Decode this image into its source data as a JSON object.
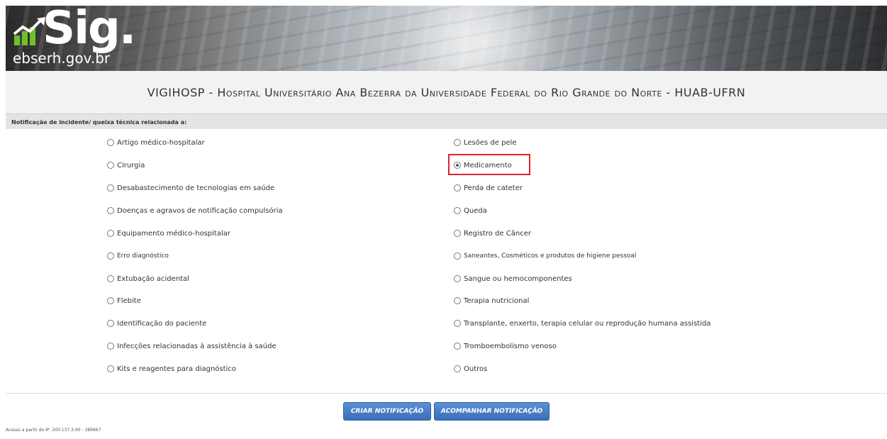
{
  "header": {
    "logo_text": "Sig",
    "logo_dot": ".",
    "logo_domain": "ebserh.gov.br",
    "logo_icon": "chart-growth-icon"
  },
  "title": "VIGIHOSP - Hospital Universitário Ana Bezerra da Universidade Federal do Rio Grande do Norte - HUAB-UFRN",
  "section": {
    "label": "Notificação de incidente/ queixa técnica relacionada a:"
  },
  "options": {
    "left": [
      {
        "label": "Artigo médico-hospitalar",
        "checked": false
      },
      {
        "label": "Cirurgia",
        "checked": false
      },
      {
        "label": "Desabastecimento de tecnologias em saúde",
        "checked": false
      },
      {
        "label": "Doenças e agravos de notificação compulsória",
        "checked": false
      },
      {
        "label": "Equipamento médico-hospitalar",
        "checked": false
      },
      {
        "label": "Erro diagnóstico",
        "checked": false
      },
      {
        "label": "Extubação acidental",
        "checked": false
      },
      {
        "label": "Flebite",
        "checked": false
      },
      {
        "label": "Identificação do paciente",
        "checked": false
      },
      {
        "label": "Infecções relacionadas à assistência à saúde",
        "checked": false
      },
      {
        "label": "Kits e reagentes para diagnóstico",
        "checked": false
      }
    ],
    "right": [
      {
        "label": "Lesões de pele",
        "checked": false
      },
      {
        "label": "Medicamento",
        "checked": true
      },
      {
        "label": "Perda de cateter",
        "checked": false
      },
      {
        "label": "Queda",
        "checked": false
      },
      {
        "label": "Registro de Câncer",
        "checked": false
      },
      {
        "label": "Saneantes, Cosméticos e produtos de higiene pessoal",
        "checked": false
      },
      {
        "label": "Sangue ou hemocomponentes",
        "checked": false
      },
      {
        "label": "Terapia nutricional",
        "checked": false
      },
      {
        "label": "Transplante, enxerto, terapia celular ou reprodução humana assistida",
        "checked": false
      },
      {
        "label": "Tromboembolismo venoso",
        "checked": false
      },
      {
        "label": "Outros",
        "checked": false
      }
    ]
  },
  "actions": {
    "create_label": "CRIAR NOTIFICAÇÃO",
    "follow_label": "ACOMPANHAR NOTIFICAÇÃO"
  },
  "footer": {
    "access_text": "Acesso a partir do IP: 200.137.3.90 - 389667"
  },
  "colors": {
    "button_blue": "#3a6fb8",
    "highlight_red": "#d9262b",
    "logo_green": "#6fbf2a"
  }
}
